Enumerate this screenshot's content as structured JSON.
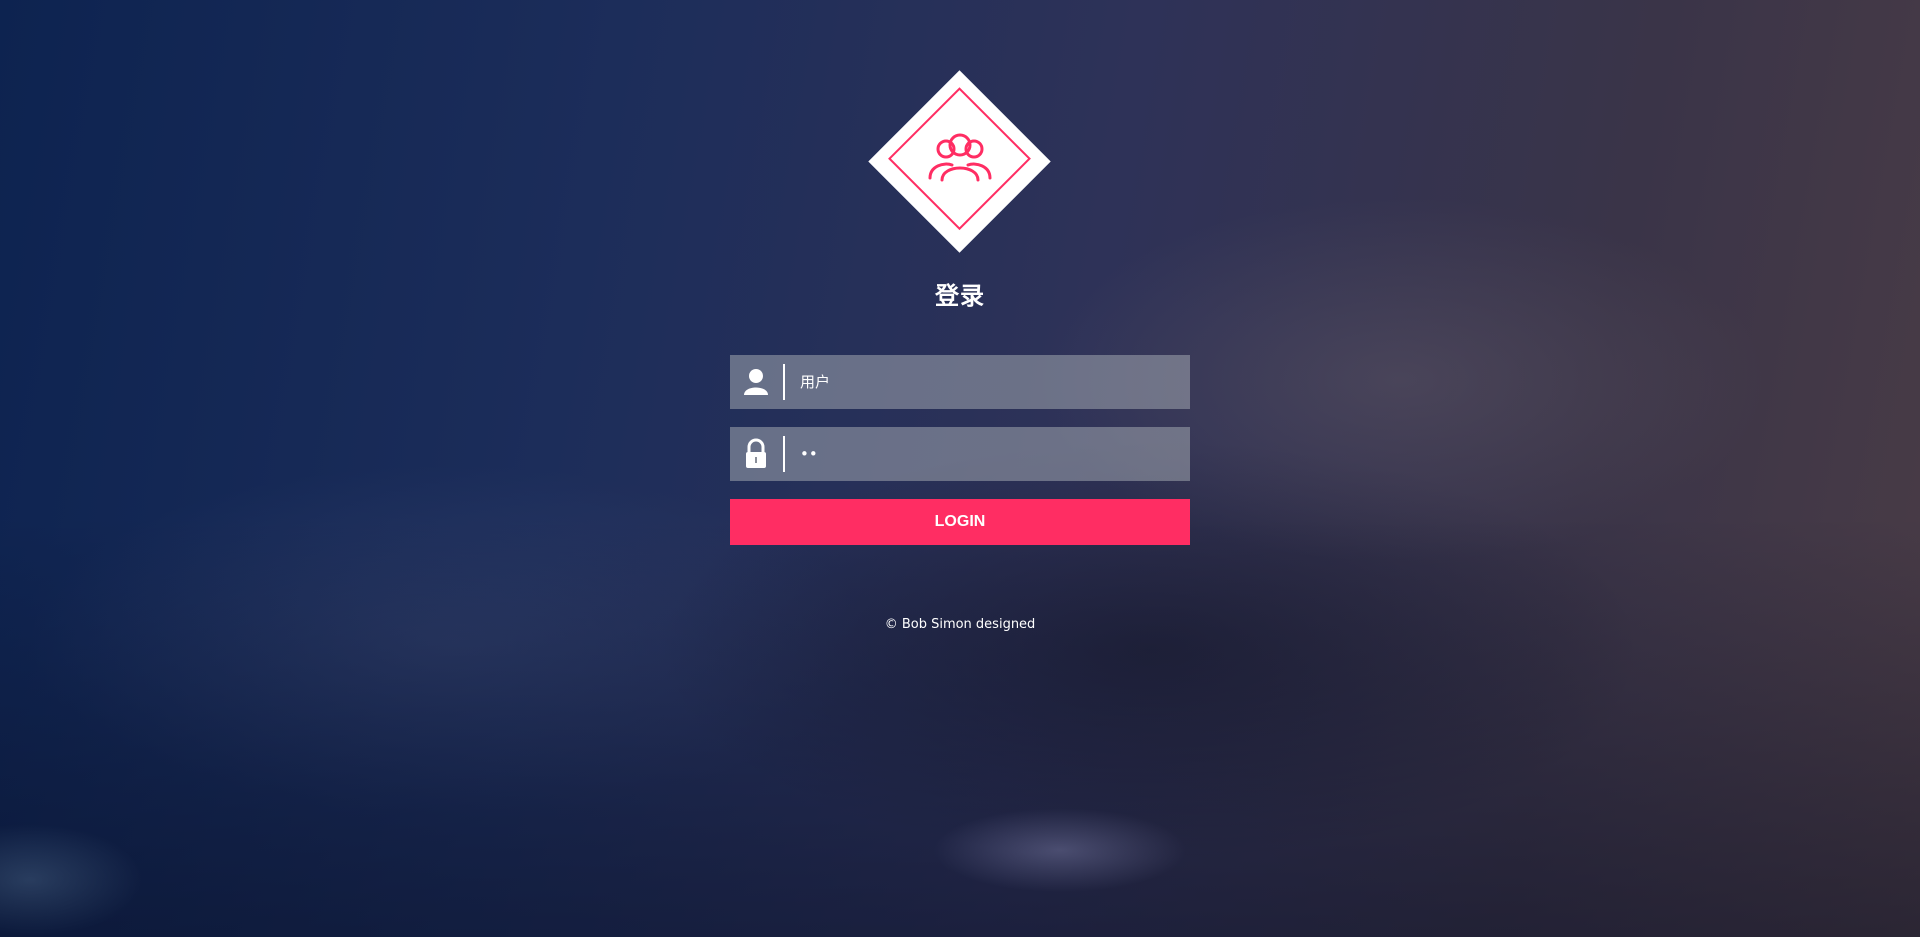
{
  "login": {
    "title": "登录",
    "username": {
      "placeholder": "用户",
      "value": "",
      "icon": "user-icon"
    },
    "password": {
      "placeholder": "",
      "value": "••",
      "icon": "lock-icon"
    },
    "button_label": "LOGIN",
    "logo_icon": "users-group-icon"
  },
  "footer": {
    "text": "© Bob Simon designed"
  },
  "colors": {
    "accent": "#ff2d63",
    "input_bg": "#a0a5af",
    "text": "#ffffff"
  }
}
